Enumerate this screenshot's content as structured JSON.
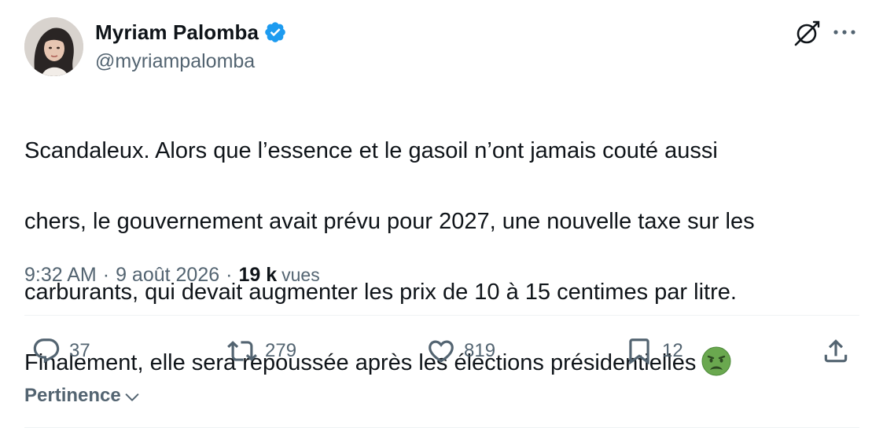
{
  "author": {
    "name": "Myriam Palomba",
    "handle": "@myriampalomba",
    "verified": true,
    "badge_color": "#1d9bf0"
  },
  "header_icons": [
    "grok-icon",
    "more-options-icon"
  ],
  "tweet": {
    "lines": [
      "Scandaleux. Alors que l’essence et le gasoil n’ont jamais couté aussi",
      "chers, le gouvernement avait prévu pour 2027, une nouvelle taxe sur les",
      "carburants, qui devait augmenter les prix de 10 à 15 centimes par litre.",
      "Finalement, elle sera repoussée après les élections présidentielles"
    ],
    "emoji": "nauseated-face-icon"
  },
  "meta": {
    "time": "9:32 AM",
    "separator": "·",
    "date": "9 août 2026",
    "views_count": "19 k",
    "views_label": "vues"
  },
  "actions": {
    "reply": {
      "icon": "reply-icon",
      "count": "37"
    },
    "repost": {
      "icon": "repost-icon",
      "count": "279"
    },
    "like": {
      "icon": "heart-icon",
      "count": "819"
    },
    "bookmark": {
      "icon": "bookmark-icon",
      "count": "12"
    },
    "share": {
      "icon": "share-icon"
    }
  },
  "sort": {
    "label": "Pertinence",
    "icon": "chevron-down-icon"
  },
  "colors": {
    "text_primary": "#0f1419",
    "text_secondary": "#536471",
    "accent": "#1d9bf0",
    "divider": "#eff3f4",
    "emoji_green": "#6aa84f"
  }
}
